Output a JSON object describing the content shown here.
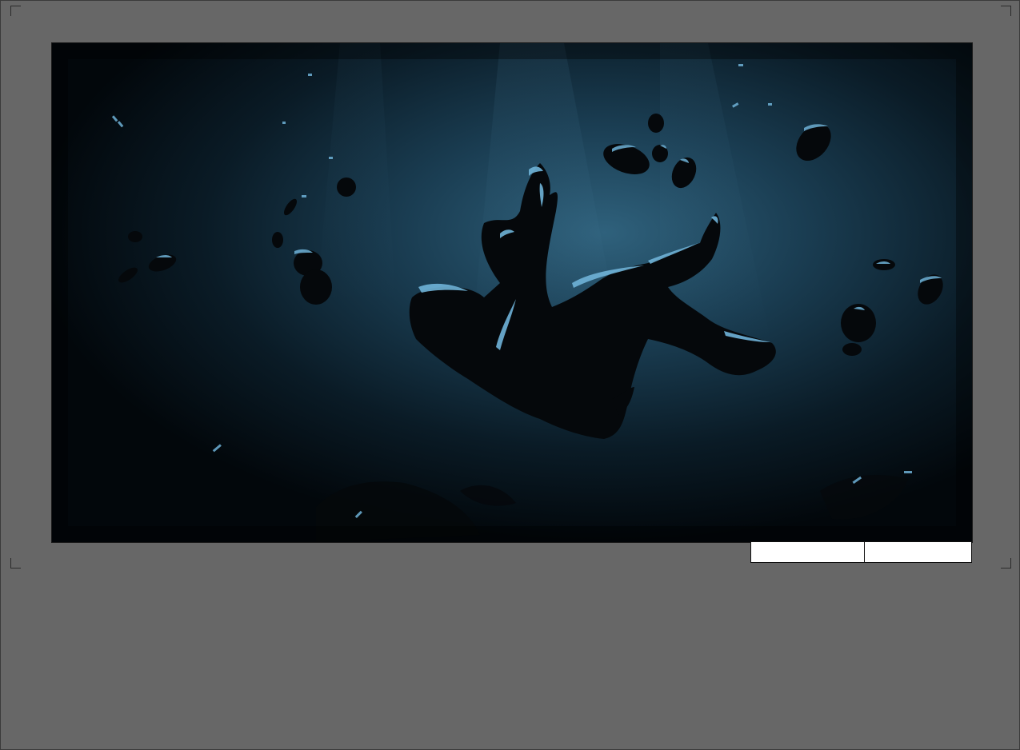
{
  "panel": {
    "scene": "",
    "shot": ""
  },
  "colors": {
    "page_background": "#676767",
    "water_glow": "#2d5d78",
    "water_dark": "#02070b",
    "highlight": "#6fb3d8",
    "silhouette": "#05080b"
  }
}
